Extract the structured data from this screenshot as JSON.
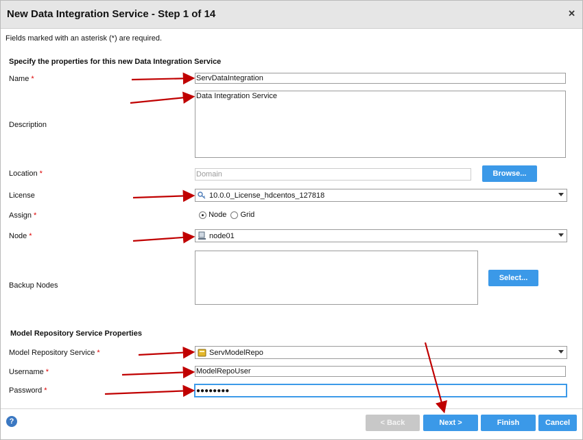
{
  "dialog": {
    "title": "New Data Integration Service - Step 1 of 14",
    "close_glyph": "✕",
    "required_note": "Fields marked with an asterisk (*) are required."
  },
  "section1": {
    "heading": "Specify the properties for this new Data Integration Service"
  },
  "fields": {
    "name": {
      "label": "Name",
      "value": "ServDataIntegration",
      "required": true
    },
    "description": {
      "label": "Description",
      "value": "Data Integration Service"
    },
    "location": {
      "label": "Location",
      "placeholder": "Domain",
      "required": true,
      "browse_label": "Browse..."
    },
    "license": {
      "label": "License",
      "value": "10.0.0_License_hdcentos_127818",
      "icon": "key-icon"
    },
    "assign": {
      "label": "Assign",
      "required": true,
      "options": [
        "Node",
        "Grid"
      ],
      "selected": "Node"
    },
    "node": {
      "label": "Node",
      "required": true,
      "value": "node01",
      "icon": "node-icon"
    },
    "backup_nodes": {
      "label": "Backup Nodes",
      "select_label": "Select..."
    }
  },
  "section2": {
    "heading": "Model Repository Service Properties"
  },
  "mrs": {
    "service": {
      "label": "Model Repository Service",
      "value": "ServModelRepo",
      "required": true,
      "icon": "repository-icon"
    },
    "username": {
      "label": "Username",
      "value": "ModelRepoUser",
      "required": true
    },
    "password": {
      "label": "Password",
      "value": "●●●●●●●●",
      "required": true
    }
  },
  "footer": {
    "help_glyph": "?",
    "back_label": "< Back",
    "next_label": "Next >",
    "finish_label": "Finish",
    "cancel_label": "Cancel"
  },
  "colors": {
    "accent": "#3b99e8",
    "annotation_arrow": "#c00000",
    "required": "#dd0000"
  }
}
